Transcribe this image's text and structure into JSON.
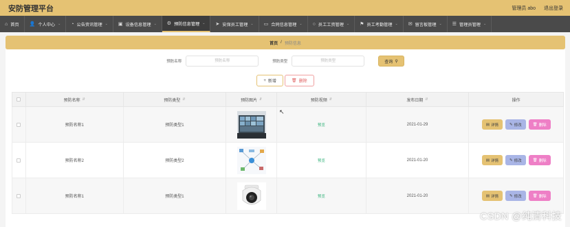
{
  "header": {
    "title": "安防管理平台",
    "user_label": "管理员 abo",
    "logout_label": "退出登录"
  },
  "nav": [
    {
      "label": "首页",
      "icon": "home-icon",
      "glyph": "⌂",
      "caret": false,
      "active": false
    },
    {
      "label": "个人中心",
      "icon": "user-icon",
      "glyph": "👤",
      "caret": true,
      "active": false
    },
    {
      "label": "公告资讯管理",
      "icon": "bell-icon",
      "glyph": "◔",
      "caret": true,
      "active": false
    },
    {
      "label": "设备信息管理",
      "icon": "device-icon",
      "glyph": "▣",
      "caret": true,
      "active": false
    },
    {
      "label": "预防信息管理",
      "icon": "gear-icon",
      "glyph": "⚙",
      "caret": true,
      "active": true
    },
    {
      "label": "安保员工管理",
      "icon": "send-icon",
      "glyph": "➤",
      "caret": true,
      "active": false
    },
    {
      "label": "合同信息管理",
      "icon": "folder-icon",
      "glyph": "▭",
      "caret": true,
      "active": false
    },
    {
      "label": "员工工资管理",
      "icon": "circle-icon",
      "glyph": "○",
      "caret": true,
      "active": false
    },
    {
      "label": "员工考勤管理",
      "icon": "flag-icon",
      "glyph": "⚑",
      "caret": true,
      "active": false
    },
    {
      "label": "留言板管理",
      "icon": "message-icon",
      "glyph": "✉",
      "caret": true,
      "active": false
    },
    {
      "label": "管理员管理",
      "icon": "list-icon",
      "glyph": "☰",
      "caret": true,
      "active": false
    }
  ],
  "breadcrumb": {
    "home": "首页",
    "separator": "/",
    "current": "预防信息"
  },
  "search": {
    "name_label": "预防名称",
    "name_placeholder": "预防名称",
    "type_label": "预防类型",
    "type_placeholder": "预防类型",
    "query_label": "查询"
  },
  "actions": {
    "add_label": "新增",
    "delete_label": "删除"
  },
  "table": {
    "columns": [
      "预防名称",
      "预防类型",
      "预防图片",
      "预防视频",
      "发布日期",
      "操作"
    ],
    "rows": [
      {
        "name": "预防名称1",
        "type": "预防类型1",
        "video": "预览",
        "date": "2021-01-29"
      },
      {
        "name": "预防名称2",
        "type": "预防类型2",
        "video": "预览",
        "date": "2021-01-20"
      },
      {
        "name": "预防名称1",
        "type": "预防类型1",
        "video": "预览",
        "date": "2021-01-20"
      }
    ],
    "op_detail": "详情",
    "op_edit": "修改",
    "op_delete": "删除"
  },
  "watermark": "CSDN @纯清科技",
  "colors": {
    "accent": "#e5c273",
    "nav_bg": "#4a4a4a",
    "edit": "#a9b5e6",
    "delete": "#ee7fc6",
    "status": "#3bb57f"
  }
}
